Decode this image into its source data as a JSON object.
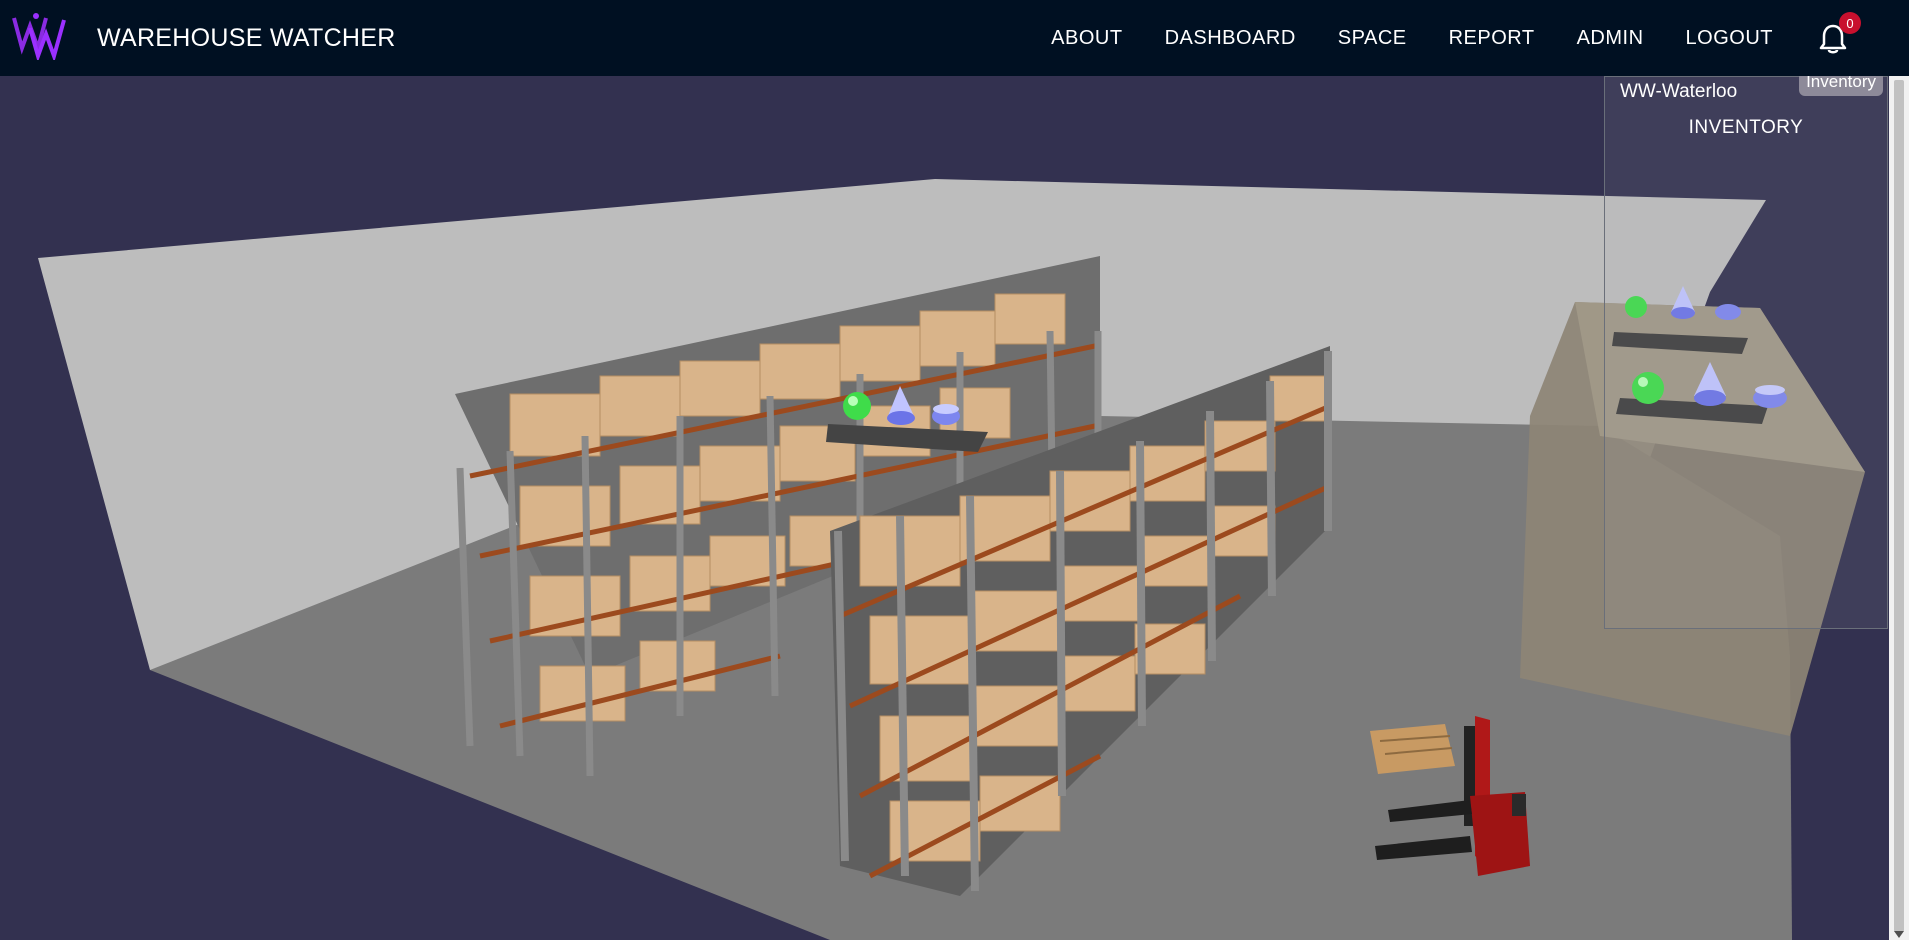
{
  "app": {
    "title": "WAREHOUSE WATCHER",
    "logo_icon": "ww-logo-icon"
  },
  "nav": {
    "items": [
      {
        "label": "ABOUT"
      },
      {
        "label": "DASHBOARD"
      },
      {
        "label": "SPACE"
      },
      {
        "label": "REPORT"
      },
      {
        "label": "ADMIN"
      },
      {
        "label": "LOGOUT"
      }
    ],
    "notifications": {
      "icon": "bell-icon",
      "count": "0"
    }
  },
  "panel": {
    "warehouse_name": "WW-Waterloo",
    "tab_label": "Inventory",
    "heading": "INVENTORY"
  },
  "colors": {
    "navbar": "#001022",
    "background": "#333150",
    "accent": "#8a2be2",
    "badge": "#c8102e"
  }
}
